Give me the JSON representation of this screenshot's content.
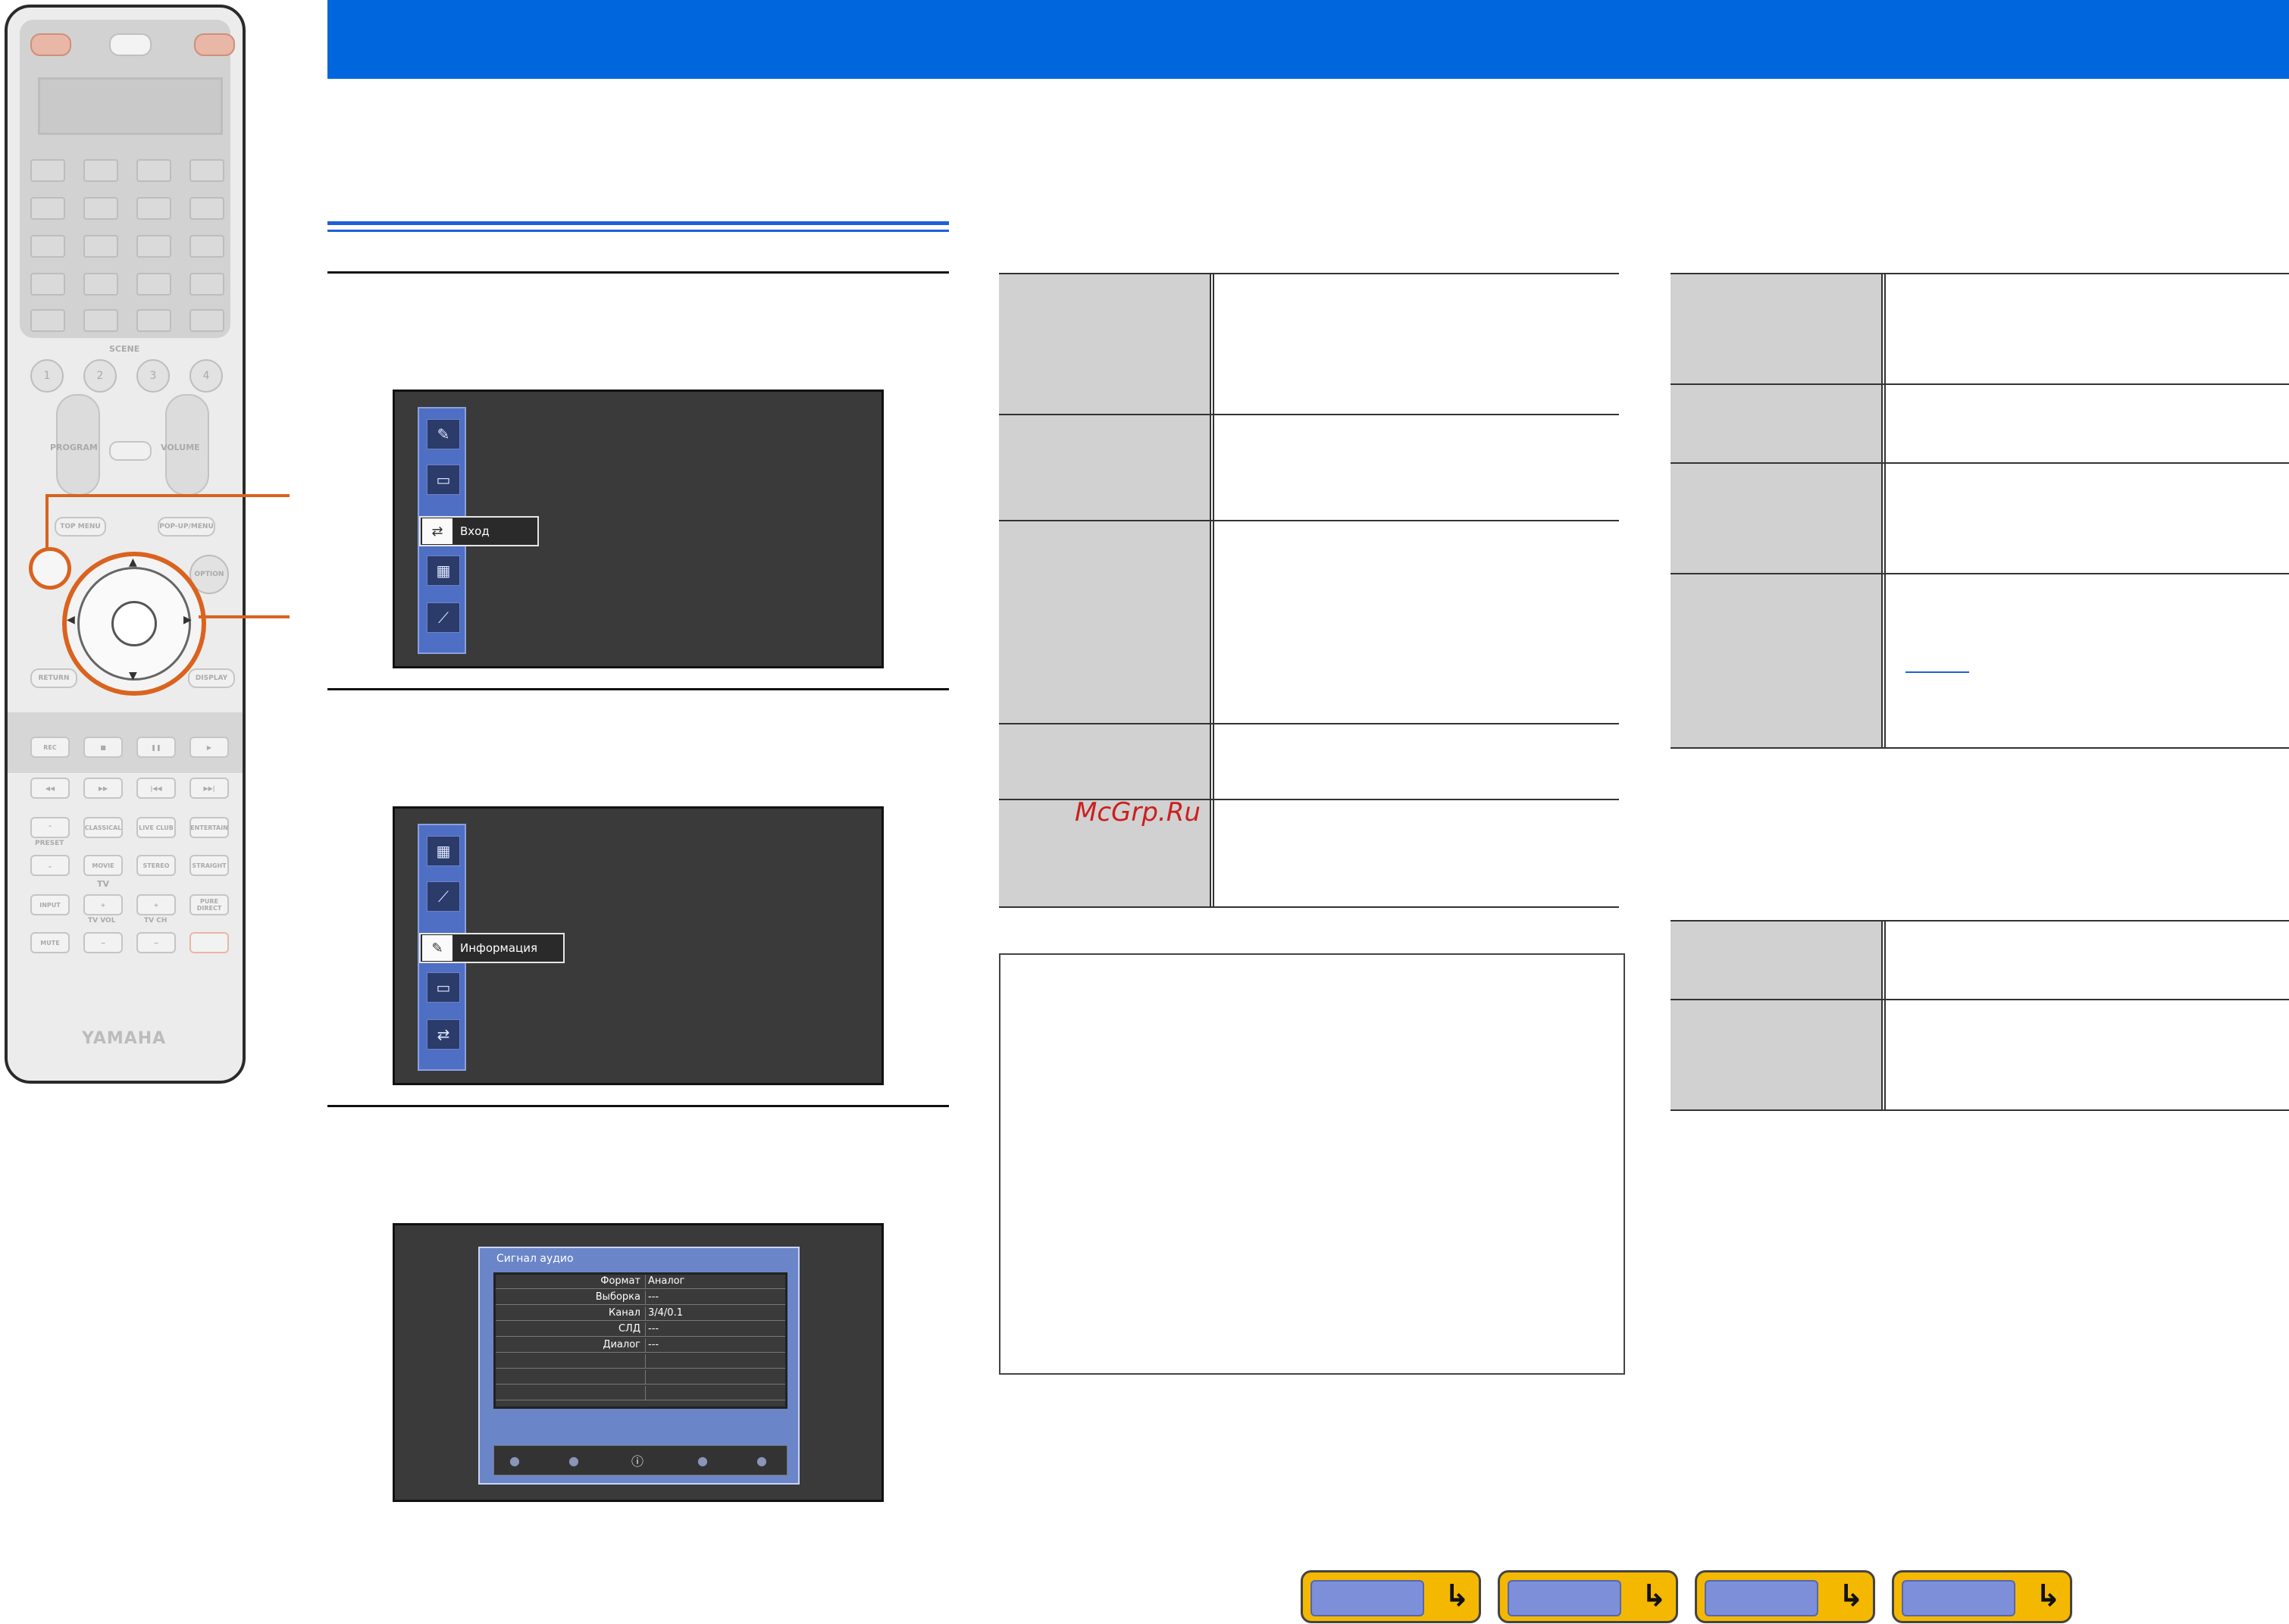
{
  "header": {
    "title": ""
  },
  "remote": {
    "brand": "YAMAHA",
    "scene_label": "SCENE",
    "scene_buttons": [
      "1",
      "2",
      "3",
      "4"
    ],
    "program_label": "PROGRAM",
    "volume_label": "VOLUME",
    "top_menu": "TOP MENU",
    "popup_menu": "POP-UP/MENU",
    "option": "OPTION",
    "return": "RETURN",
    "display": "DISPLAY",
    "rec": "REC",
    "preset": "PRESET",
    "tv": "TV",
    "tv_vol": "TV VOL",
    "tv_ch": "TV CH",
    "sound_buttons": [
      "CLASSICAL",
      "LIVE CLUB",
      "ENTERTAIN",
      "MOVIE",
      "STEREO",
      "STRAIGHT",
      "INPUT",
      "PURE DIRECT",
      "MUTE"
    ]
  },
  "screens": {
    "screen1_selected": "Вход",
    "screen2_selected": "Информация",
    "audio_panel": {
      "title": "Сигнал аудио",
      "rows": [
        {
          "label": "Формат",
          "value": "Аналог"
        },
        {
          "label": "Выборка",
          "value": "---"
        },
        {
          "label": "Канал",
          "value": "3/4/0.1"
        },
        {
          "label": "СЛД",
          "value": "---"
        },
        {
          "label": "Диалог",
          "value": "---"
        },
        {
          "label": "",
          "value": ""
        },
        {
          "label": "",
          "value": ""
        },
        {
          "label": "",
          "value": ""
        }
      ]
    }
  },
  "watermark": "McGrp.Ru",
  "colors": {
    "header": "#0066dd",
    "accent_orange": "#d9631f",
    "nav_button": "#f4b800"
  }
}
